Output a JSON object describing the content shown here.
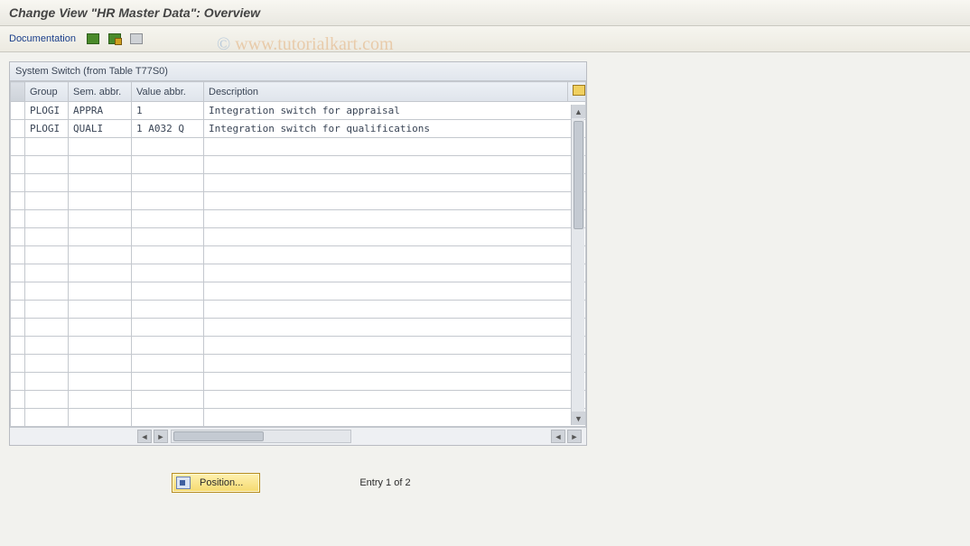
{
  "title": "Change View \"HR Master Data\": Overview",
  "toolbar": {
    "documentation_label": "Documentation"
  },
  "watermark": {
    "c": "©",
    "text": " www.tutorialkart.com"
  },
  "panel": {
    "title": "System Switch (from Table T77S0)",
    "columns": {
      "group": "Group",
      "sem": "Sem. abbr.",
      "val": "Value abbr.",
      "desc": "Description"
    },
    "rows": [
      {
        "group": "PLOGI",
        "sem": "APPRA",
        "val": "1",
        "desc": "Integration switch for appraisal"
      },
      {
        "group": "PLOGI",
        "sem": "QUALI",
        "val": "1 A032 Q",
        "desc": "Integration switch for qualifications"
      }
    ]
  },
  "footer": {
    "position_label": "Position...",
    "entry_text": "Entry 1 of 2"
  }
}
